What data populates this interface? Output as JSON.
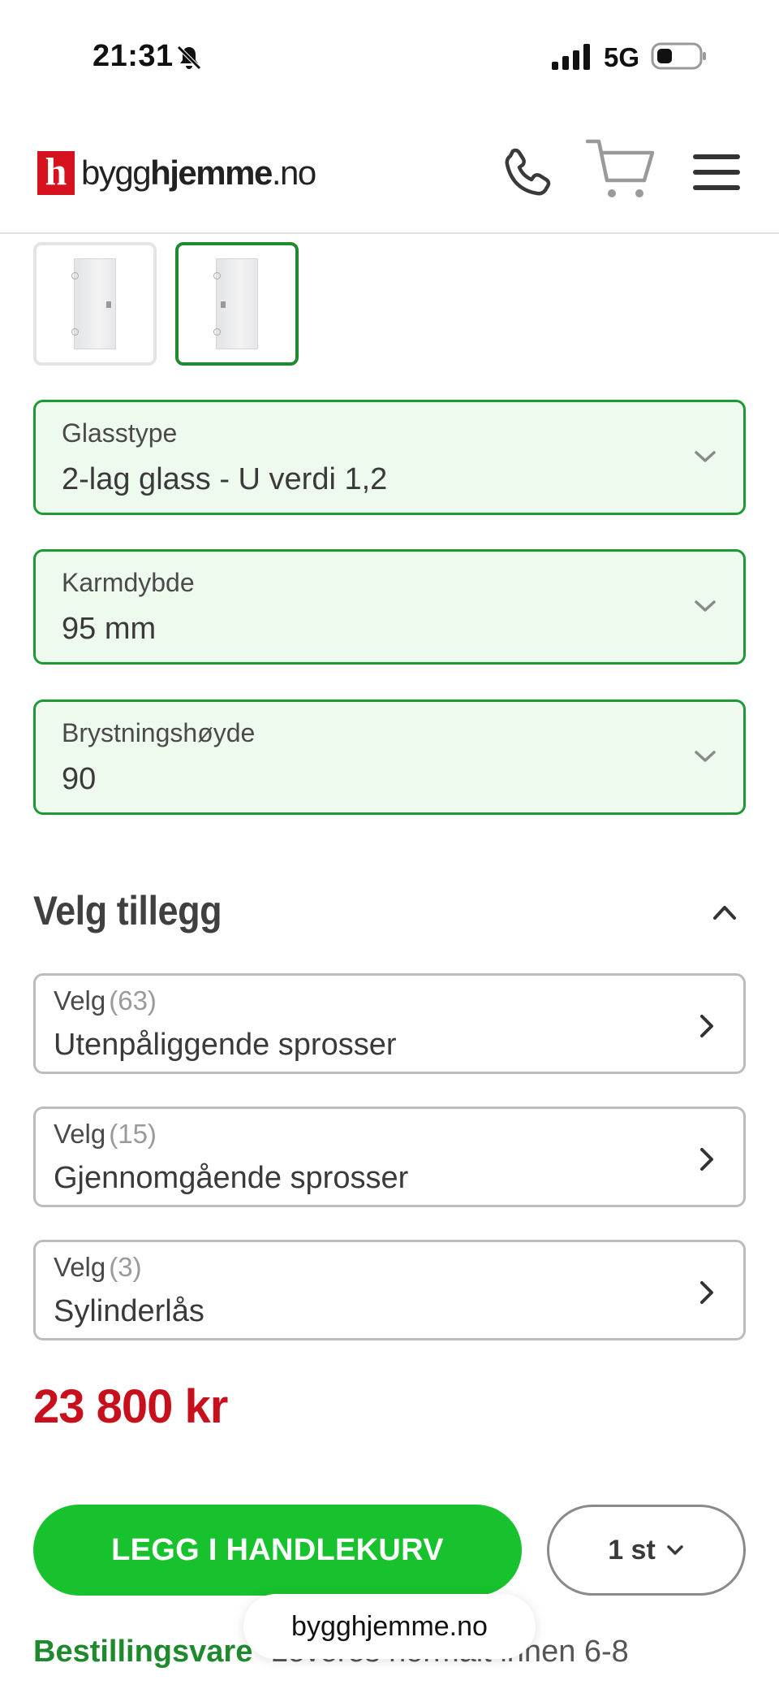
{
  "status_bar": {
    "time": "21:31",
    "network": "5G"
  },
  "header": {
    "logo_mark": "h",
    "logo_text_regular": "bygg",
    "logo_text_bold": "hjemme",
    "logo_text_suffix": ".no"
  },
  "selects": [
    {
      "label": "Glasstype",
      "value": "2-lag glass - U verdi 1,2"
    },
    {
      "label": "Karmdybde",
      "value": "95 mm"
    },
    {
      "label": "Brystningshøyde",
      "value": "90"
    }
  ],
  "addons_section": {
    "title": "Velg tillegg",
    "items": [
      {
        "prefix": "Velg",
        "count": "(63)",
        "name": "Utenpåliggende sprosser"
      },
      {
        "prefix": "Velg",
        "count": "(15)",
        "name": "Gjennomgående sprosser"
      },
      {
        "prefix": "Velg",
        "count": "(3)",
        "name": "Sylinderlås"
      }
    ]
  },
  "price": "23 800 kr",
  "add_to_cart_label": "LEGG I HANDLEKURV",
  "quantity": "1 st",
  "availability": {
    "status": "Bestillingsvare",
    "text": "Leveres normalt innen 6-8"
  },
  "browser": {
    "url": "bygghjemme.no"
  },
  "colors": {
    "brand_red": "#d6121f",
    "price_red": "#c8101d",
    "cta_green": "#17c22e",
    "select_green": "#1e9a35",
    "select_bg": "#eefaee"
  }
}
